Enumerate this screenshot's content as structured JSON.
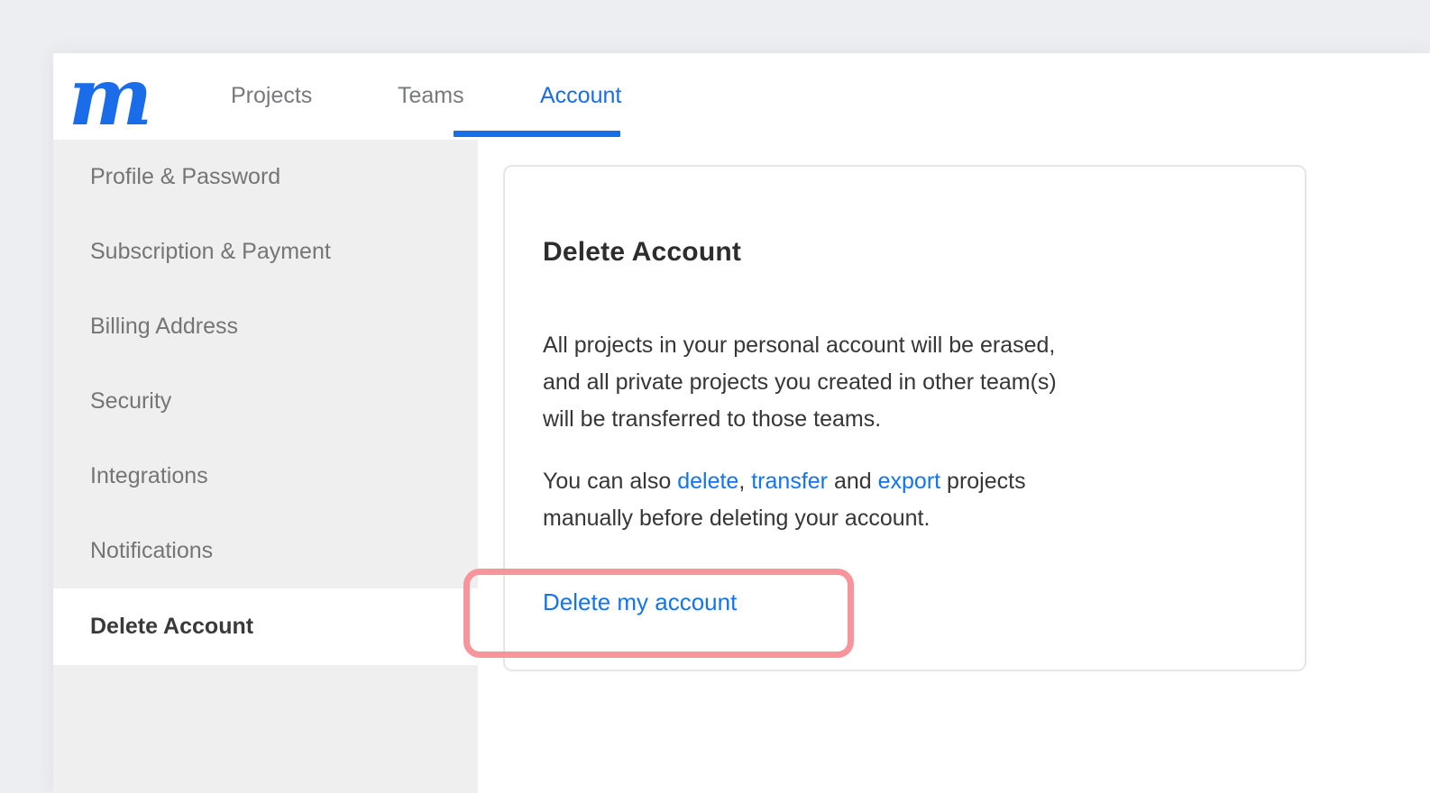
{
  "brand": {
    "logo_letter": "m"
  },
  "nav": {
    "tabs": [
      {
        "label": "Projects",
        "active": false
      },
      {
        "label": "Teams",
        "active": false
      },
      {
        "label": "Account",
        "active": true
      }
    ]
  },
  "sidebar": {
    "items": [
      {
        "label": "Profile & Password",
        "active": false
      },
      {
        "label": "Subscription & Payment",
        "active": false
      },
      {
        "label": "Billing Address",
        "active": false
      },
      {
        "label": "Security",
        "active": false
      },
      {
        "label": "Integrations",
        "active": false
      },
      {
        "label": "Notifications",
        "active": false
      },
      {
        "label": "Delete Account",
        "active": true
      }
    ]
  },
  "main": {
    "card": {
      "title": "Delete Account",
      "paragraph1": "All projects in your personal account will be erased,\nand all private projects you created in other team(s)\nwill be transferred to those teams.",
      "paragraph2": {
        "prefix": "You can also ",
        "link_delete": "delete",
        "sep1": ", ",
        "link_transfer": "transfer",
        "sep2": " and ",
        "link_export": "export",
        "suffix": " projects\nmanually before deleting your account."
      },
      "delete_link": "Delete my account"
    }
  },
  "colors": {
    "brand_blue": "#1a6ce8",
    "link_blue": "#1473f0",
    "annotation_red": "#f8949c",
    "outer_bg": "#eceef1",
    "sidebar_bg": "#efefef"
  }
}
